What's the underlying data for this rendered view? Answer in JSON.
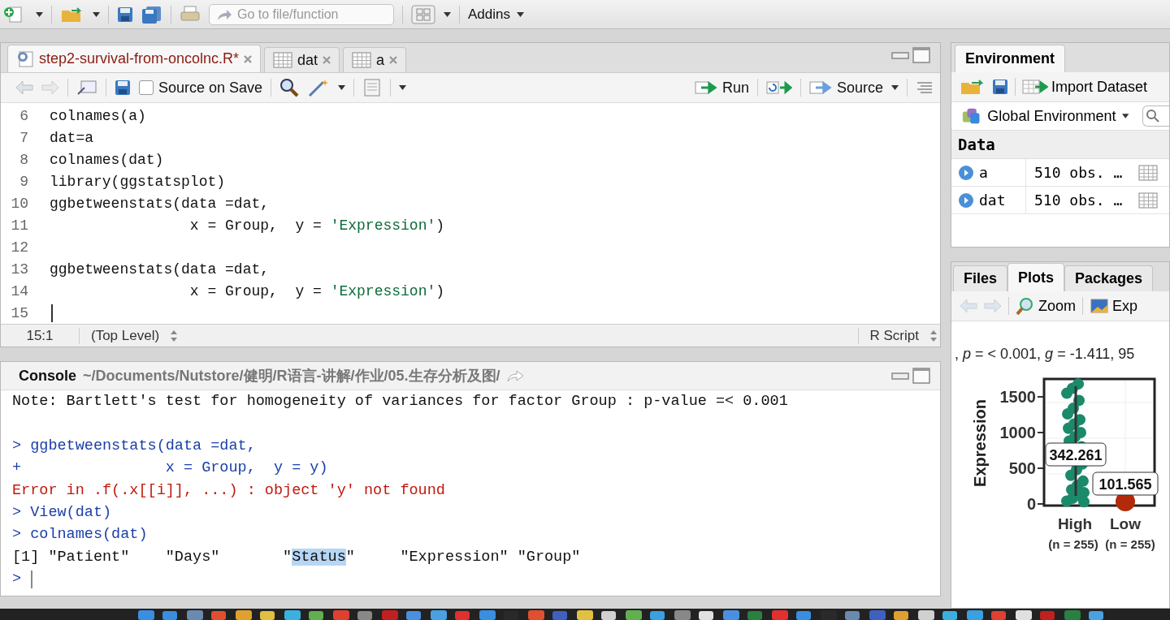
{
  "main_toolbar": {
    "search": {
      "placeholder": "Go to file/function"
    },
    "addins": "Addins"
  },
  "editor": {
    "tabs": [
      {
        "label": "step2-survival-from-oncolnc.R*",
        "kind": "script",
        "selected": true
      },
      {
        "label": "dat",
        "kind": "data",
        "selected": false
      },
      {
        "label": "a",
        "kind": "data",
        "selected": false
      }
    ],
    "toolbar": {
      "source_on_save": {
        "label": "Source on Save",
        "checked": false
      },
      "run": "Run",
      "source": "Source"
    },
    "lines": [
      {
        "number": "6",
        "tokens": [
          {
            "kind": "plain",
            "text": "colnames(a)"
          }
        ]
      },
      {
        "number": "7",
        "tokens": [
          {
            "kind": "plain",
            "text": "dat=a"
          }
        ]
      },
      {
        "number": "8",
        "tokens": [
          {
            "kind": "plain",
            "text": "colnames(dat)"
          }
        ]
      },
      {
        "number": "9",
        "tokens": [
          {
            "kind": "plain",
            "text": "library(ggstatsplot)"
          }
        ]
      },
      {
        "number": "10",
        "tokens": [
          {
            "kind": "plain",
            "text": "ggbetweenstats(data =dat,"
          }
        ]
      },
      {
        "number": "11",
        "tokens": [
          {
            "kind": "plain",
            "text": "                x = Group,  y = "
          },
          {
            "kind": "string",
            "text": "'Expression'"
          },
          {
            "kind": "plain",
            "text": ")"
          }
        ]
      },
      {
        "number": "12"
      },
      {
        "number": "13",
        "tokens": [
          {
            "kind": "plain",
            "text": "ggbetweenstats(data =dat,"
          }
        ]
      },
      {
        "number": "14",
        "tokens": [
          {
            "kind": "plain",
            "text": "                x = Group,  y = "
          },
          {
            "kind": "string",
            "text": "'Expression'"
          },
          {
            "kind": "plain",
            "text": ")"
          }
        ]
      },
      {
        "number": "15",
        "cursor": true
      }
    ],
    "status": {
      "position": "15:1",
      "scope": "(Top Level)",
      "file_type": "R Script"
    }
  },
  "console": {
    "title": "Console",
    "path": "~/Documents/Nutstore/健明/R语言-讲解/作业/05.生存分析及图/",
    "lines": [
      {
        "tokens": [
          {
            "kind": "output",
            "text": "Note: Bartlett's test for homogeneity of variances for factor Group : p-value =< 0.001"
          }
        ]
      },
      {
        "kind": "blank"
      },
      {
        "tokens": [
          {
            "kind": "input",
            "text": "> ggbetweenstats(data =dat,"
          }
        ]
      },
      {
        "tokens": [
          {
            "kind": "input",
            "text": "+                x = Group,  y = y)"
          }
        ]
      },
      {
        "tokens": [
          {
            "kind": "error",
            "text": "Error in .f(.x[[i]], ...) : object 'y' not found"
          }
        ]
      },
      {
        "tokens": [
          {
            "kind": "input",
            "text": "> View(dat)"
          }
        ]
      },
      {
        "tokens": [
          {
            "kind": "input",
            "text": "> colnames(dat)"
          }
        ]
      },
      {
        "tokens": [
          {
            "kind": "output",
            "text": "[1] \"Patient\"    \"Days\"       \""
          },
          {
            "kind": "selected",
            "text": "Status"
          },
          {
            "kind": "output",
            "text": "\"     \"Expression\" \"Group\""
          }
        ]
      },
      {
        "tokens": [
          {
            "kind": "input",
            "text": ">"
          }
        ],
        "cursor": true
      }
    ]
  },
  "environment": {
    "tabs": [
      {
        "label": "Environment",
        "selected": true
      }
    ],
    "import": "Import Dataset",
    "scope": "Global Environment",
    "section": "Data",
    "rows": [
      {
        "name": "a",
        "value": "510 obs. …"
      },
      {
        "name": "dat",
        "value": "510 obs. …"
      }
    ]
  },
  "files": {
    "tabs": [
      {
        "label": "Files",
        "selected": false
      },
      {
        "label": "Plots",
        "selected": true
      },
      {
        "label": "Packages",
        "selected": false
      }
    ],
    "zoom": "Zoom",
    "export": "Exp",
    "plot": {
      "subtitle": ", *p* = < 0.001, *g* = -1.411, 95",
      "ylabel": "Expression",
      "yticks": [
        "1500",
        "1000",
        "500",
        "0"
      ],
      "groups": [
        {
          "label": "High",
          "n": "(n = 255)",
          "value": "342.261",
          "color": "#1b8a6b"
        },
        {
          "label": "Low",
          "n": "(n = 255)",
          "value": "101.565",
          "color": "#b22a0a"
        }
      ]
    }
  }
}
